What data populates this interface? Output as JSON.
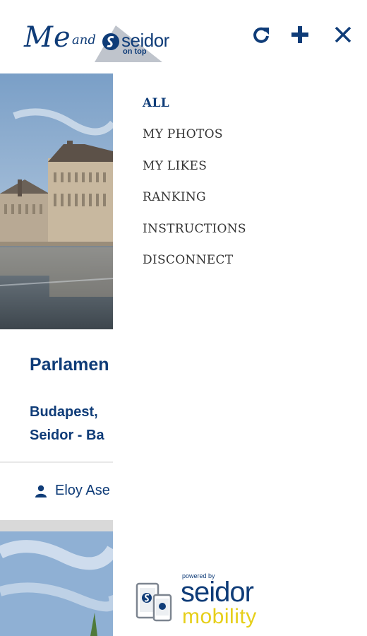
{
  "header": {
    "logo_me": "Me",
    "logo_and": "and",
    "logo_brand": "seidor",
    "logo_tagline": "on top",
    "refresh_icon": "refresh-icon",
    "add_icon": "plus-icon",
    "close_icon": "close-icon"
  },
  "feed": {
    "card_title": "Parlamen",
    "card_location_line1": "Budapest,",
    "card_location_line2": "Seidor - Ba",
    "card_author": "Eloy Ase",
    "user_icon": "user-icon"
  },
  "menu": {
    "items": [
      {
        "label": "ALL"
      },
      {
        "label": "MY PHOTOS"
      },
      {
        "label": "MY LIKES"
      },
      {
        "label": "RANKING"
      },
      {
        "label": "INSTRUCTIONS"
      },
      {
        "label": "DISCONNECT"
      }
    ],
    "active_index": 0
  },
  "footer": {
    "powered_by": "powered by",
    "brand_line1": "seidor",
    "brand_line2": "mobility"
  },
  "colors": {
    "brand_blue": "#0f3c78",
    "mobility_yellow": "#e6cf1a",
    "menu_text": "#333333"
  }
}
